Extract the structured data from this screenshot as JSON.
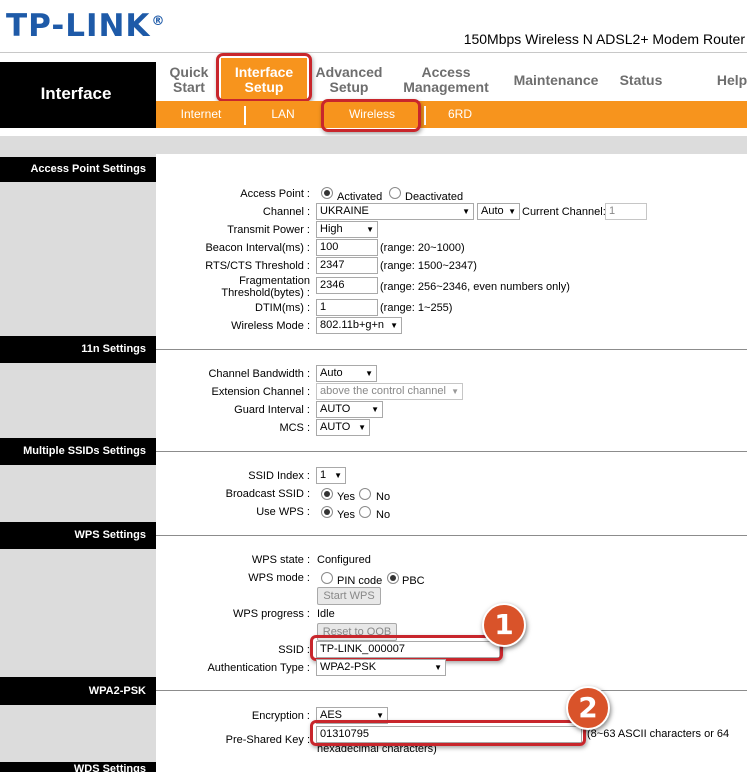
{
  "header": {
    "logo": "TP-LINK",
    "logo_mark": "®",
    "model": "150Mbps Wireless N ADSL2+ Modem Router"
  },
  "nav": {
    "section_title": "Interface",
    "tabs": [
      {
        "line1": "Quick",
        "line2": "Start"
      },
      {
        "line1": "Interface",
        "line2": "Setup"
      },
      {
        "line1": "Advanced",
        "line2": "Setup"
      },
      {
        "line1": "Access",
        "line2": "Management"
      },
      {
        "line1": "Maintenance",
        "line2": ""
      },
      {
        "line1": "Status",
        "line2": ""
      },
      {
        "line1": "Help",
        "line2": ""
      }
    ],
    "subtabs": [
      "Internet",
      "LAN",
      "Wireless",
      "6RD"
    ]
  },
  "sections": {
    "ap": "Access Point Settings",
    "n11": "11n Settings",
    "mssid": "Multiple SSIDs Settings",
    "wps": "WPS Settings",
    "wpa2": "WPA2-PSK",
    "wds": "WDS Settings"
  },
  "ap": {
    "access_point_label": "Access Point :",
    "activated": "Activated",
    "deactivated": "Deactivated",
    "channel_label": "Channel :",
    "channel_value": "UKRAINE",
    "channel_auto": "Auto",
    "current_channel_label": "Current Channel:",
    "current_channel_value": "1",
    "tx_power_label": "Transmit Power :",
    "tx_power_value": "High",
    "beacon_label": "Beacon Interval(ms) :",
    "beacon_value": "100",
    "beacon_range": "(range: 20~1000)",
    "rts_label": "RTS/CTS Threshold :",
    "rts_value": "2347",
    "rts_range": "(range: 1500~2347)",
    "frag_label_1": "Fragmentation",
    "frag_label_2": "Threshold(bytes) :",
    "frag_value": "2346",
    "frag_range": "(range: 256~2346, even numbers only)",
    "dtim_label": "DTIM(ms) :",
    "dtim_value": "1",
    "dtim_range": "(range: 1~255)",
    "mode_label": "Wireless Mode :",
    "mode_value": "802.11b+g+n"
  },
  "n11": {
    "bw_label": "Channel Bandwidth :",
    "bw_value": "Auto",
    "ext_label": "Extension Channel :",
    "ext_value": "above the control channel",
    "gi_label": "Guard Interval :",
    "gi_value": "AUTO",
    "mcs_label": "MCS :",
    "mcs_value": "AUTO"
  },
  "mssid": {
    "index_label": "SSID Index :",
    "index_value": "1",
    "broadcast_label": "Broadcast SSID :",
    "use_wps_label": "Use WPS :",
    "yes": "Yes",
    "no": "No"
  },
  "wps": {
    "state_label": "WPS state :",
    "state_value": "Configured",
    "mode_label": "WPS mode :",
    "pin_code": "PIN code",
    "pbc": "PBC",
    "start_wps": "Start WPS",
    "progress_label": "WPS progress :",
    "progress_value": "Idle",
    "reset_oob": "Reset to OOB",
    "ssid_label": "SSID :",
    "ssid_value": "TP-LINK_000007",
    "auth_label": "Authentication Type :",
    "auth_value": "WPA2-PSK"
  },
  "wpa2": {
    "enc_label": "Encryption :",
    "enc_value": "AES",
    "psk_label": "Pre-Shared Key :",
    "psk_value": "01310795",
    "psk_hint_1": "(8~63 ASCII characters or 64",
    "psk_hint_2": "hexadecimal characters)"
  },
  "callouts": [
    "1",
    "2"
  ],
  "colors": {
    "brand_blue": "#1e5aa8",
    "accent_orange": "#f7941d",
    "highlight_red": "#c8262c",
    "badge": "#d9532a"
  }
}
